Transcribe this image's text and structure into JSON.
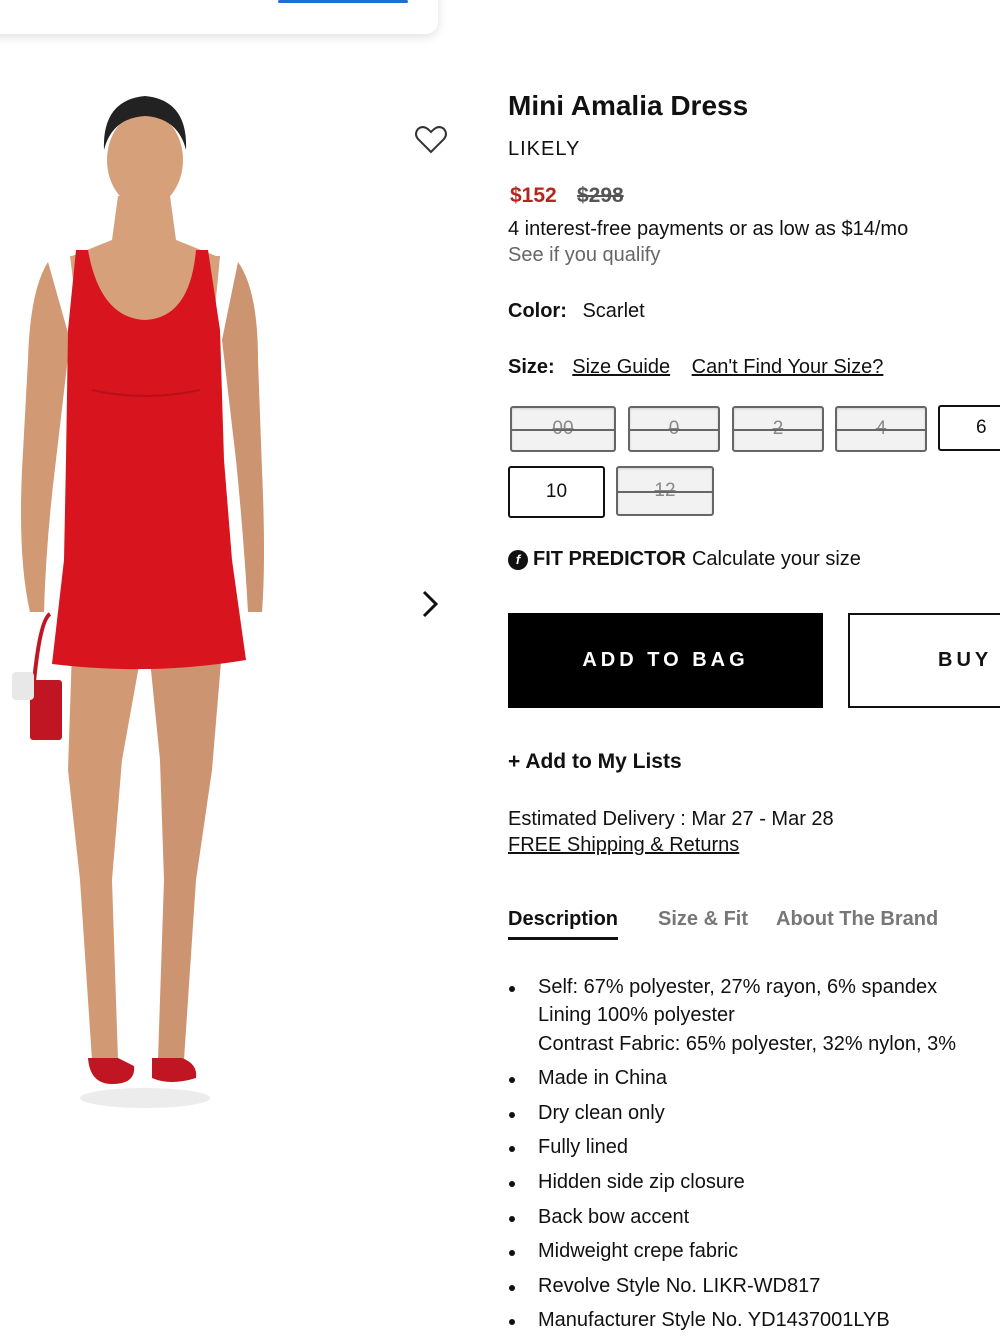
{
  "product": {
    "title": "Mini Amalia Dress",
    "brand": "LIKELY",
    "price_sale": "$152",
    "price_original": "$298",
    "installments": "4 interest-free payments or as low as $14/mo",
    "qualify": "See if you qualify",
    "color_label": "Color:",
    "color_value": "Scarlet"
  },
  "size": {
    "label": "Size:",
    "guide": "Size Guide",
    "cant_find": "Can't Find Your Size?",
    "options": [
      {
        "label": "00",
        "available": false
      },
      {
        "label": "0",
        "available": false
      },
      {
        "label": "2",
        "available": false
      },
      {
        "label": "4",
        "available": false
      },
      {
        "label": "6",
        "available": true
      },
      {
        "label": "10",
        "available": true
      },
      {
        "label": "12",
        "available": false
      }
    ]
  },
  "fit_predictor": {
    "icon_text": "f",
    "title": "FIT PREDICTOR",
    "text": "Calculate your size"
  },
  "actions": {
    "add_to_bag": "ADD TO BAG",
    "buy_now": "BUY",
    "add_to_lists": "+ Add to My Lists"
  },
  "delivery": {
    "estimate": "Estimated Delivery : Mar 27 - Mar 28",
    "shipping_link": "FREE Shipping & Returns"
  },
  "tabs": [
    {
      "label": "Description",
      "active": true
    },
    {
      "label": "Size & Fit",
      "active": false
    },
    {
      "label": "About The Brand",
      "active": false
    }
  ],
  "description": {
    "first_item": "Self: 67% polyester, 27% rayon, 6% spandex",
    "first_item_sub1": "Lining 100% polyester",
    "first_item_sub2": "Contrast Fabric: 65% polyester, 32% nylon, 3%",
    "items": [
      "Made in China",
      "Dry clean only",
      "Fully lined",
      "Hidden side zip closure",
      "Back bow accent",
      "Midweight crepe fabric",
      "Revolve Style No. LIKR-WD817",
      "Manufacturer Style No. YD1437001LYB"
    ]
  },
  "icons": {
    "wishlist": "heart-outline-icon",
    "next_image": "chevron-right-icon"
  },
  "colors": {
    "sale_price": "#b3261e",
    "dress": "#d8141e",
    "button_black": "#000000"
  }
}
